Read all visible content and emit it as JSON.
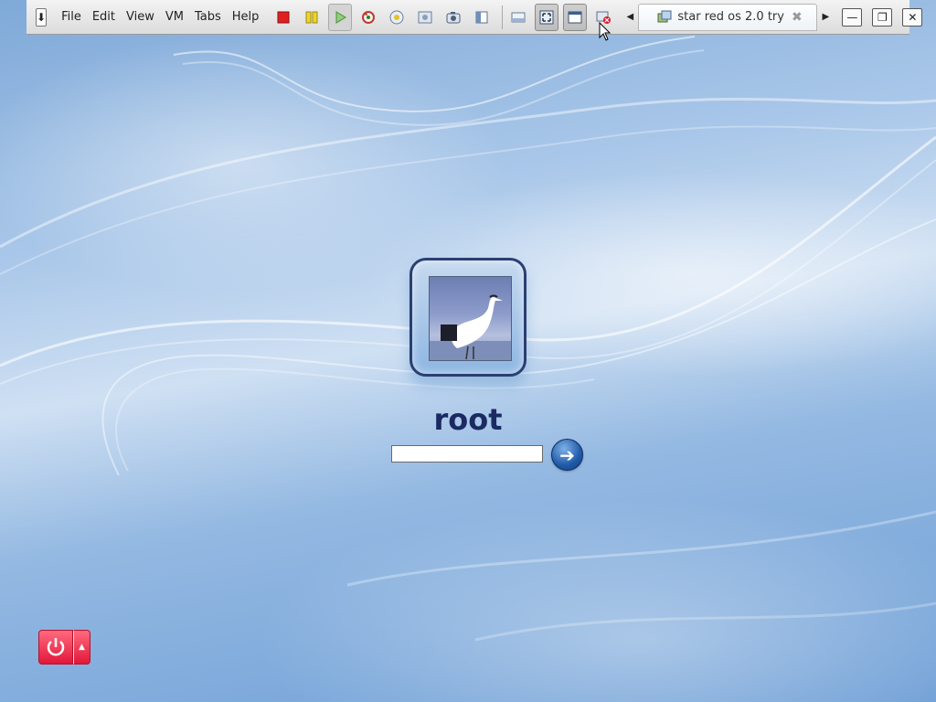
{
  "toolbar": {
    "pin_icon": "pin-icon",
    "menus": [
      "File",
      "Edit",
      "View",
      "VM",
      "Tabs",
      "Help"
    ],
    "tools": [
      {
        "name": "power-off-button",
        "icon": "stop-icon",
        "color": "#e02020"
      },
      {
        "name": "suspend-button",
        "icon": "pause-icon",
        "color": "#e8d020"
      },
      {
        "name": "power-on-button",
        "icon": "play-icon",
        "color": "#5ab03c"
      },
      {
        "name": "revert-snapshot-button",
        "icon": "revert-icon"
      },
      {
        "name": "take-snapshot-button",
        "icon": "snapshot-icon"
      },
      {
        "name": "snapshot-manager-button",
        "icon": "snapshot-manager-icon"
      },
      {
        "name": "capture-screen-button",
        "icon": "camera-icon"
      },
      {
        "name": "show-sidebar-button",
        "icon": "sidebar-icon"
      },
      {
        "name": "show-console-button",
        "icon": "console-icon"
      },
      {
        "name": "fullscreen-button",
        "icon": "fullscreen-icon"
      },
      {
        "name": "unity-button",
        "icon": "unity-icon"
      },
      {
        "name": "close-tab-view-button",
        "icon": "close-vm-icon"
      }
    ]
  },
  "tab": {
    "label": "star red os 2.0 try",
    "close_glyph": "✖"
  },
  "window": {
    "minimize": "—",
    "restore": "❐",
    "close": "✕"
  },
  "login": {
    "username": "root",
    "password_value": "",
    "go_glyph": "➔"
  },
  "power": {
    "menu_glyph": "▲"
  },
  "colors": {
    "username": "#1b2a62",
    "power": "#e3173a",
    "go_button": "#1e5aa8"
  }
}
